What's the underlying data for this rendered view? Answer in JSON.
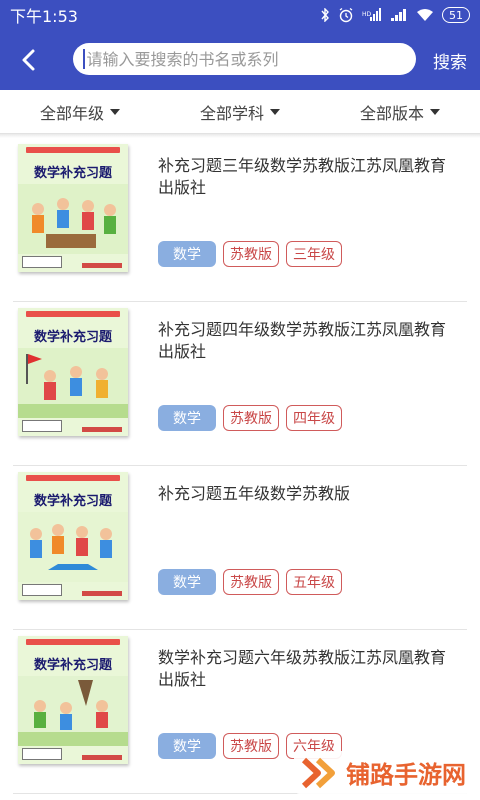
{
  "status_bar": {
    "time": "下午1:53",
    "battery": "51"
  },
  "toolbar": {
    "search_placeholder": "请输入要搜索的书名或系列",
    "search_value": "",
    "search_button": "搜索"
  },
  "filters": [
    {
      "label": "全部年级"
    },
    {
      "label": "全部学科"
    },
    {
      "label": "全部版本"
    }
  ],
  "books": [
    {
      "title": "补充习题三年级数学苏教版江苏凤凰教育出版社",
      "cover_title": "数学补充习题",
      "tags": {
        "subject": "数学",
        "edition": "苏教版",
        "grade": "三年级"
      }
    },
    {
      "title": "补充习题四年级数学苏教版江苏凤凰教育出版社",
      "cover_title": "数学补充习题",
      "tags": {
        "subject": "数学",
        "edition": "苏教版",
        "grade": "四年级"
      }
    },
    {
      "title": "补充习题五年级数学苏教版",
      "cover_title": "数学补充习题",
      "tags": {
        "subject": "数学",
        "edition": "苏教版",
        "grade": "五年级"
      }
    },
    {
      "title": "数学补充习题六年级苏教版江苏凤凰教育出版社",
      "cover_title": "数学补充习题",
      "tags": {
        "subject": "数学",
        "edition": "苏教版",
        "grade": "六年级"
      }
    }
  ],
  "colors": {
    "primary": "#3c4fc0",
    "subject_tag": "#8aaee0",
    "outline_tag": "#d05b5b",
    "watermark": "#e8632f"
  },
  "watermark": {
    "text": "铺路手游网"
  }
}
